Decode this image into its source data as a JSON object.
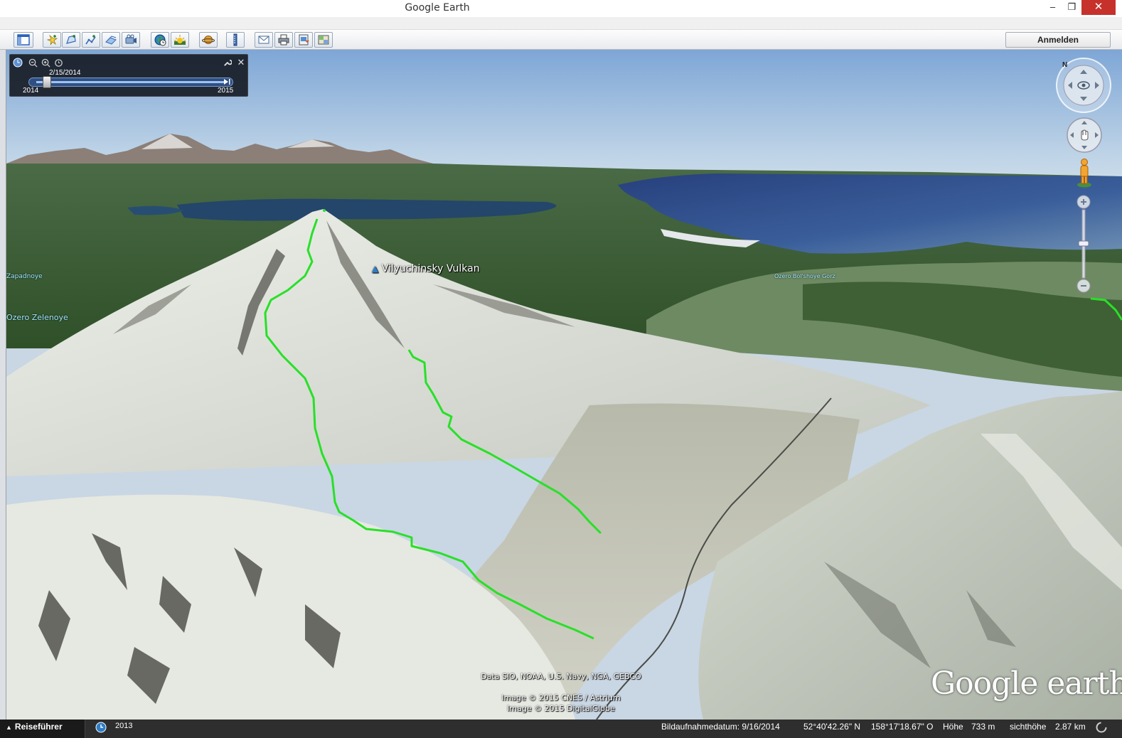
{
  "window": {
    "title": "Google Earth",
    "minimize": "–",
    "maximize": "❐",
    "close": "✕"
  },
  "toolbar": {
    "buttons": [
      {
        "name": "sidebar-toggle-button",
        "icon": "sidebar-icon"
      },
      {
        "name": "add-placemark-button",
        "icon": "placemark-icon"
      },
      {
        "name": "add-polygon-button",
        "icon": "polygon-icon"
      },
      {
        "name": "add-path-button",
        "icon": "path-icon"
      },
      {
        "name": "add-image-overlay-button",
        "icon": "overlay-icon"
      },
      {
        "name": "record-tour-button",
        "icon": "record-icon"
      },
      {
        "name": "historical-imagery-button",
        "icon": "clock-globe-icon"
      },
      {
        "name": "sunlight-button",
        "icon": "sun-icon"
      },
      {
        "name": "switch-planet-button",
        "icon": "planet-icon"
      },
      {
        "name": "ruler-button",
        "icon": "ruler-icon"
      },
      {
        "name": "email-button",
        "icon": "mail-icon"
      },
      {
        "name": "print-button",
        "icon": "print-icon"
      },
      {
        "name": "save-image-button",
        "icon": "save-image-icon"
      },
      {
        "name": "view-in-maps-button",
        "icon": "maps-icon"
      }
    ],
    "signin_label": "Anmelden"
  },
  "time_slider": {
    "current_date": "2/15/2014",
    "start_label": "2014",
    "end_label": "2015",
    "position": 0.06
  },
  "map": {
    "place_label": "Vilyuchinsky Vulkan",
    "side_labels": [
      "Zapadnoye",
      "Ozero Zelenoye",
      "Ozero Bol'shoye Gorz"
    ],
    "attribution_data": "Data SIO, NOAA, U.S. Navy, NGA, GEBCO",
    "attribution_image1": "Image © 2015 CNES / Astrium",
    "attribution_image2": "Image © 2015 DigitalGlobe",
    "logo_text": "Google earth"
  },
  "status_bar": {
    "tour_guide": "Reiseführer",
    "historical_year": "2013",
    "imagery_date": "Bildaufnahmedatum: 9/16/2014",
    "latitude": "52°40'42.26\" N",
    "longitude": "158°17'18.67\" O",
    "elevation_label": "Höhe",
    "elevation": "733 m",
    "eye_alt_label": "sichthöhe",
    "eye_alt": "2.87 km"
  },
  "colors": {
    "track": "#28e028",
    "sky_top": "#a9c4e2",
    "ocean": "#2f4a8a",
    "snow": "#d9dcd4",
    "forest": "#3d5e32",
    "titlebar_close": "#c7312b"
  }
}
